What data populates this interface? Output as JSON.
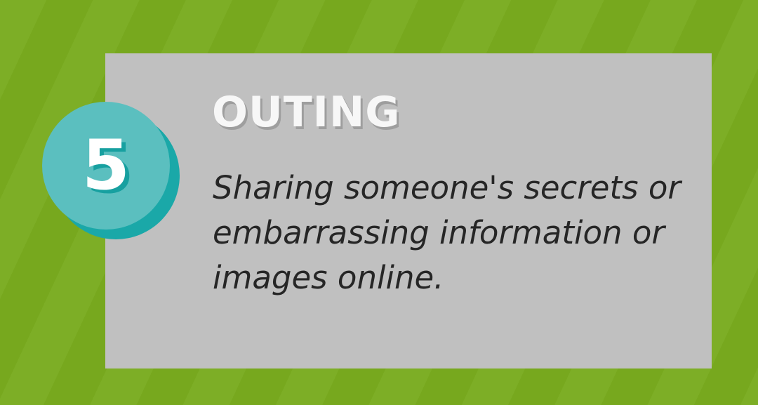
{
  "colors": {
    "background": "#79ab1f",
    "card": "#c0c0c0",
    "badge": "#5bbfbf",
    "badge_shadow": "#1aa8a8",
    "title": "#f7f7f7",
    "text": "#262626"
  },
  "badge": {
    "number": "5"
  },
  "title": "OUTING",
  "description": "Sharing someone's secrets or embarrassing information or images online."
}
